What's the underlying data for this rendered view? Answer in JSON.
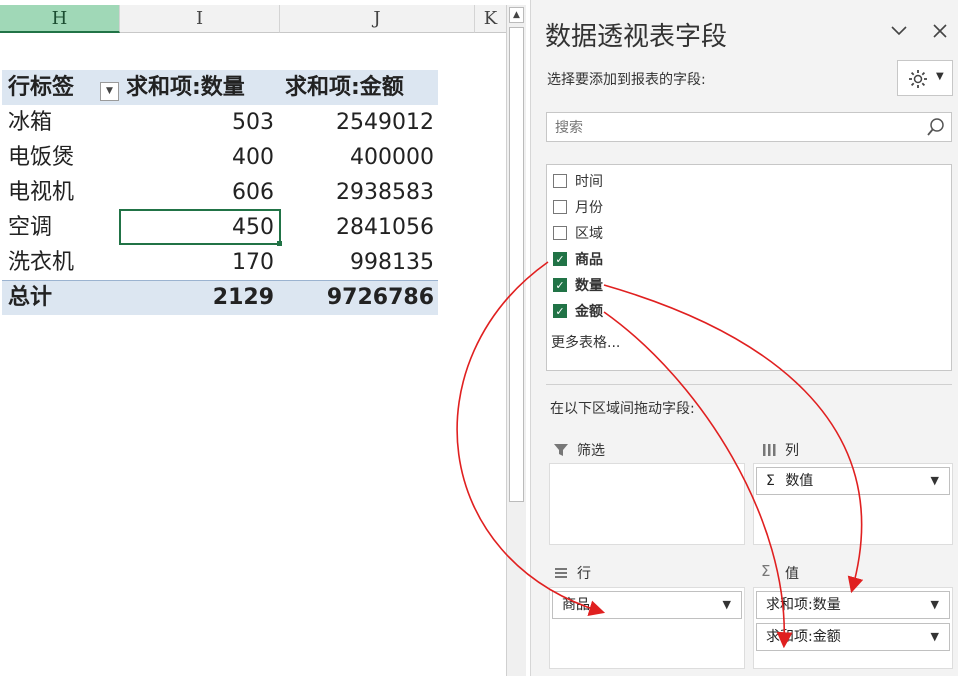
{
  "sheet": {
    "columns": [
      "H",
      "I",
      "J",
      "K"
    ],
    "pivot": {
      "header": [
        "行标签",
        "求和项:数量",
        "求和项:金额"
      ],
      "rows": [
        {
          "label": "冰箱",
          "qty": "503",
          "amount": "2549012"
        },
        {
          "label": "电饭煲",
          "qty": "400",
          "amount": "400000"
        },
        {
          "label": "电视机",
          "qty": "606",
          "amount": "2938583"
        },
        {
          "label": "空调",
          "qty": "450",
          "amount": "2841056"
        },
        {
          "label": "洗衣机",
          "qty": "170",
          "amount": "998135"
        }
      ],
      "total": {
        "label": "总计",
        "qty": "2129",
        "amount": "9726786"
      }
    },
    "selected_cell": "I",
    "colors": {
      "header_fill": "#dce6f1",
      "selected_border": "#217346"
    }
  },
  "panel": {
    "title": "数据透视表字段",
    "subtitle": "选择要添加到报表的字段:",
    "search_placeholder": "搜索",
    "fields": [
      {
        "label": "时间",
        "checked": false
      },
      {
        "label": "月份",
        "checked": false
      },
      {
        "label": "区域",
        "checked": false
      },
      {
        "label": "商品",
        "checked": true
      },
      {
        "label": "数量",
        "checked": true
      },
      {
        "label": "金额",
        "checked": true
      }
    ],
    "more_tables": "更多表格...",
    "drag_hint": "在以下区域间拖动字段:",
    "areas": {
      "filter": {
        "label": "筛选"
      },
      "columns": {
        "label": "列",
        "items": [
          "数值"
        ]
      },
      "rows": {
        "label": "行",
        "items": [
          "商品"
        ]
      },
      "values": {
        "label": "值",
        "items": [
          "求和项:数量",
          "求和项:金额"
        ]
      }
    },
    "annotation_color": "#e02020"
  }
}
